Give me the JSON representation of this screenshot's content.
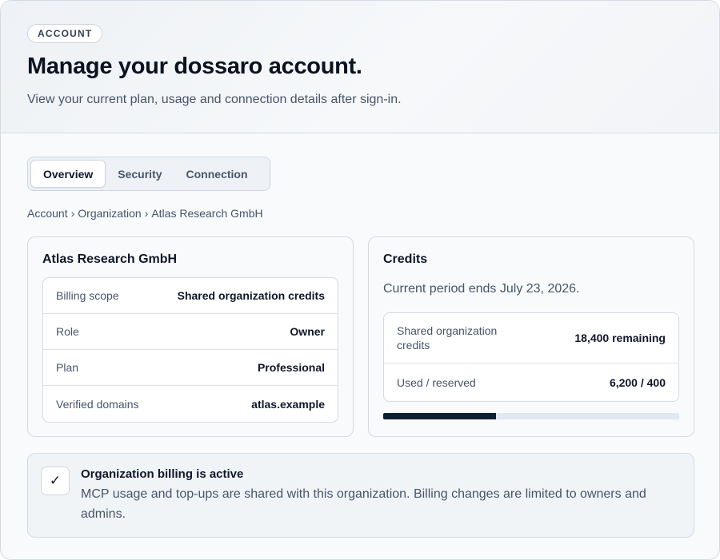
{
  "header": {
    "eyebrow": "ACCOUNT",
    "title": "Manage your dossaro account.",
    "subtitle": "View your current plan, usage and connection details after sign-in."
  },
  "tabs": [
    {
      "label": "Overview",
      "active": true
    },
    {
      "label": "Security",
      "active": false
    },
    {
      "label": "Connection",
      "active": false
    }
  ],
  "breadcrumb": {
    "items": [
      "Account",
      "Organization",
      "Atlas Research GmbH"
    ],
    "separator": "›"
  },
  "org_card": {
    "title": "Atlas Research GmbH",
    "rows": [
      {
        "label": "Billing scope",
        "value": "Shared organization credits"
      },
      {
        "label": "Role",
        "value": "Owner"
      },
      {
        "label": "Plan",
        "value": "Professional"
      },
      {
        "label": "Verified domains",
        "value": "atlas.example"
      }
    ]
  },
  "credits_card": {
    "title": "Credits",
    "period": "Current period ends July 23, 2026.",
    "rows": [
      {
        "label": "Shared organization credits",
        "value": "18,400 remaining"
      },
      {
        "label": "Used / reserved",
        "value": "6,200 / 400"
      }
    ],
    "usage_fraction": 0.38
  },
  "notice": {
    "title": "Organization billing is active",
    "body": "MCP usage and top-ups are shared with this organization. Billing changes are limited to owners and admins.",
    "icon": "check-icon"
  },
  "colors": {
    "accent_dark": "#0f1f33",
    "muted_text": "#475569",
    "border": "#d5dbe3"
  }
}
